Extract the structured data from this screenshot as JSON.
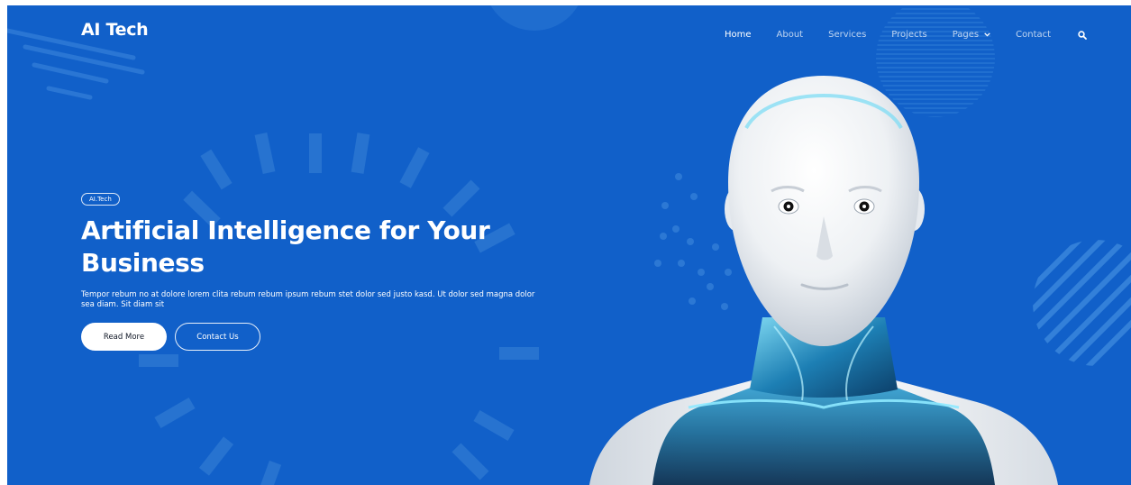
{
  "nav": {
    "brand": "AI Tech",
    "links": [
      {
        "label": "Home",
        "active": true
      },
      {
        "label": "About",
        "active": false
      },
      {
        "label": "Services",
        "active": false
      },
      {
        "label": "Projects",
        "active": false
      },
      {
        "label": "Pages",
        "active": false,
        "has_dropdown": true
      },
      {
        "label": "Contact",
        "active": false
      }
    ],
    "search_icon": "search-icon"
  },
  "hero": {
    "badge": "AI.Tech",
    "title": "Artificial Intelligence for Your Business",
    "description": "Tempor rebum no at dolore lorem clita rebum rebum ipsum rebum stet dolor sed justo kasd. Ut dolor sed magna dolor sea diam. Sit diam sit",
    "primary_button": "Read More",
    "secondary_button": "Contact Us"
  },
  "colors": {
    "background": "#1160c9",
    "text": "#ffffff",
    "primary_button_bg": "#ffffff",
    "primary_button_text": "#111827"
  }
}
